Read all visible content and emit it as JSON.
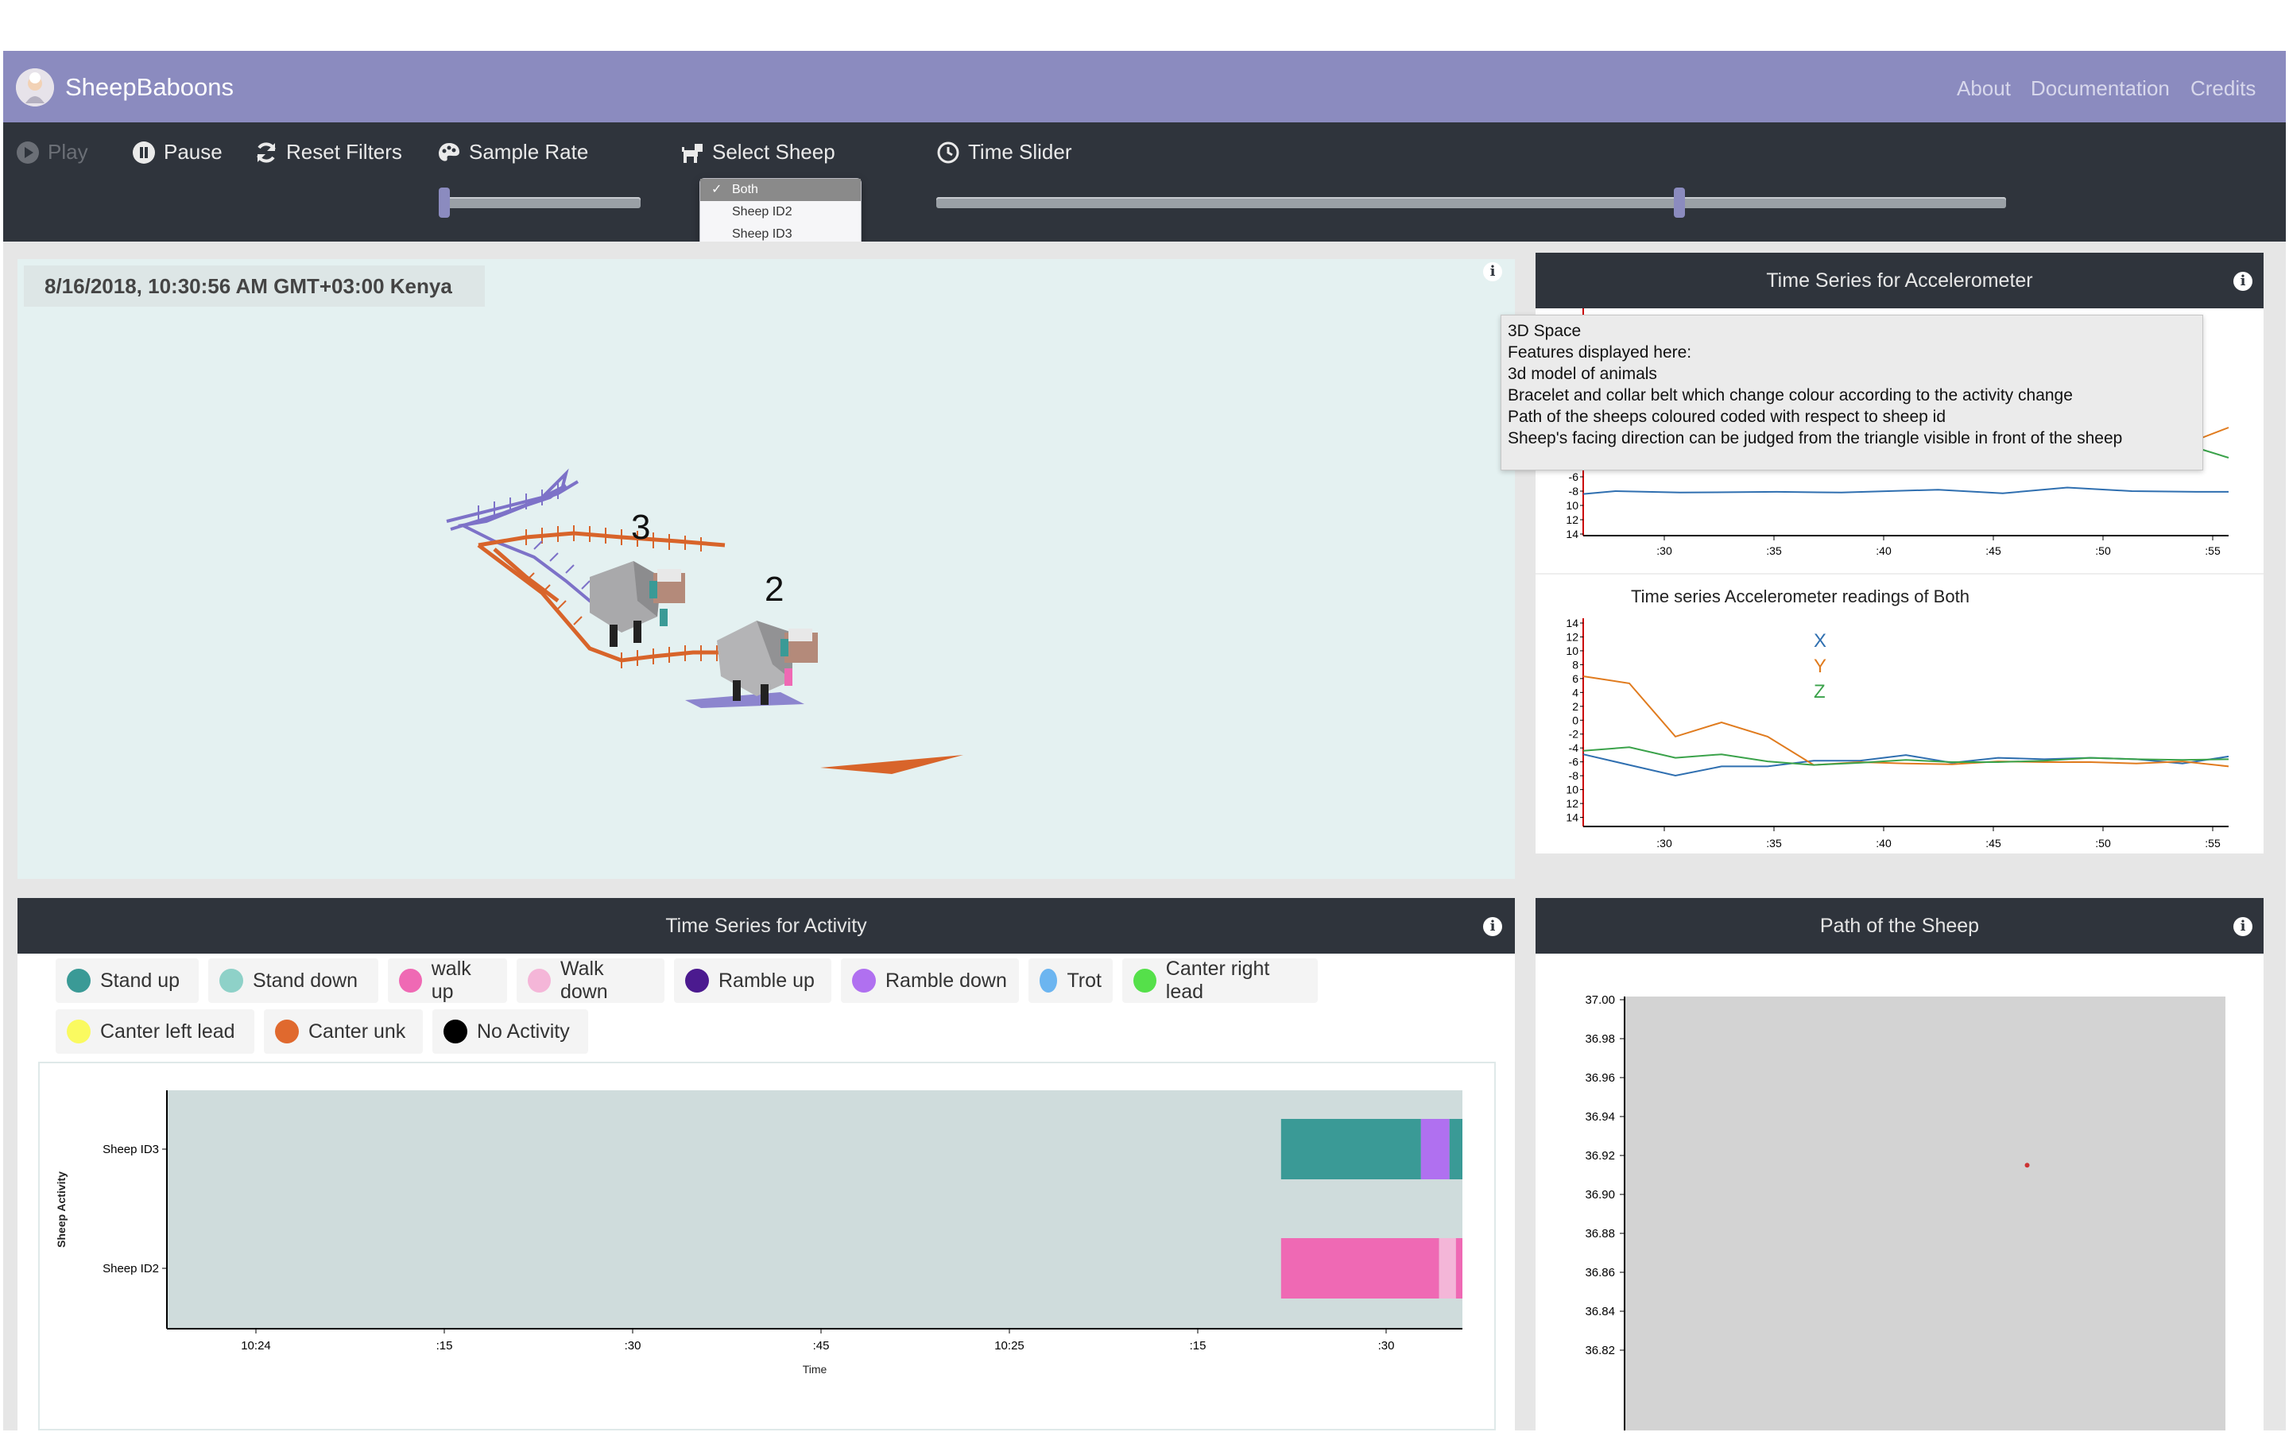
{
  "app": {
    "brand": "SheepBaboons"
  },
  "nav": {
    "about": "About",
    "documentation": "Documentation",
    "credits": "Credits"
  },
  "toolbar": {
    "play": "Play",
    "pause": "Pause",
    "reset": "Reset Filters",
    "sample_rate": "Sample Rate",
    "select_sheep": "Select Sheep",
    "time_slider": "Time Slider",
    "sheep_options": [
      "Both",
      "Sheep ID2",
      "Sheep ID3"
    ],
    "selected_sheep": "Both"
  },
  "scene": {
    "timestamp": "8/16/2018, 10:30:56 AM GMT+03:00 Kenya",
    "labels": [
      "3",
      "2"
    ],
    "tooltip": [
      "3D Space",
      "Features displayed here:",
      "3d model of animals",
      "Bracelet and collar belt which change colour according to the activity change",
      "Path of the sheeps coloured coded with respect to sheep id",
      "Sheep's facing direction can be judged from the triangle visible in front of the sheep"
    ]
  },
  "accel_panel": {
    "title": "Time Series for Accelerometer",
    "chart2_title": "Time series Accelerometer readings of Both",
    "legend": [
      "X",
      "Y",
      "Z"
    ]
  },
  "activity_panel": {
    "title": "Time Series for Activity",
    "legend": [
      {
        "label": "Stand up",
        "color": "#3a9a96"
      },
      {
        "label": "Stand down",
        "color": "#8ed1c8"
      },
      {
        "label": "walk up",
        "color": "#ef69b4"
      },
      {
        "label": "Walk down",
        "color": "#f4b6d8"
      },
      {
        "label": "Ramble up",
        "color": "#4b1a8f"
      },
      {
        "label": "Ramble down",
        "color": "#b070f0"
      },
      {
        "label": "Trot",
        "color": "#6cb5f0"
      },
      {
        "label": "Canter right lead",
        "color": "#55e04a"
      },
      {
        "label": "Canter left lead",
        "color": "#fafa60"
      },
      {
        "label": "Canter unk",
        "color": "#e0692e"
      },
      {
        "label": "No Activity",
        "color": "#000000"
      }
    ]
  },
  "path_panel": {
    "title": "Path of the Sheep"
  },
  "chart_data": [
    {
      "type": "line",
      "title": "",
      "x_ticks": [
        ":30",
        ":35",
        ":40",
        ":45",
        ":50",
        ":55"
      ],
      "y_ticks": [
        "-6",
        "-8",
        "10",
        "12",
        "14"
      ],
      "series": [
        {
          "color": "#2f6fb0",
          "x": [
            0,
            0.05,
            0.15,
            0.3,
            0.4,
            0.55,
            0.65,
            0.75,
            0.85,
            0.95,
            1
          ],
          "y": [
            -8.4,
            -8.0,
            -8.2,
            -8.1,
            -8.2,
            -7.8,
            -8.3,
            -7.5,
            -8.0,
            -8.1,
            -8.1
          ]
        }
      ]
    },
    {
      "type": "line",
      "title": "Time series Accelerometer readings of Both",
      "x_ticks": [
        ":30",
        ":35",
        ":40",
        ":45",
        ":50",
        ":55"
      ],
      "y_ticks": [
        "14",
        "12",
        "10",
        "8",
        "6",
        "4",
        "2",
        "0",
        "-2",
        "-4",
        "-6",
        "-8",
        "10",
        "12",
        "14"
      ],
      "series": [
        {
          "name": "X",
          "color": "#2f6fb0",
          "y": [
            -4.5,
            -6,
            -7.5,
            -6.2,
            -6.2,
            -5.4,
            -5.4,
            -4.6,
            -5.7,
            -5.0,
            -5.2,
            -5.0,
            -5.2,
            -5.8,
            -4.8
          ]
        },
        {
          "name": "Y",
          "color": "#e07b1e",
          "y": [
            6.5,
            5.5,
            -2,
            0,
            -2,
            -6,
            -5.6,
            -5.8,
            -5.9,
            -5.5,
            -5.6,
            -5.6,
            -5.8,
            -5.5,
            -6.2
          ]
        },
        {
          "name": "Z",
          "color": "#3aa24a",
          "y": [
            -4,
            -3.5,
            -5,
            -4.5,
            -5.5,
            -6,
            -5.7,
            -5.3,
            -5.6,
            -5.6,
            -5.4,
            -5.0,
            -5.2,
            -5.3,
            -5.2
          ]
        }
      ]
    },
    {
      "type": "bar",
      "ylabel": "Sheep Activity",
      "xlabel": "Time",
      "x_ticks": [
        "10:24",
        ":15",
        ":30",
        ":45",
        "10:25",
        ":15",
        ":30"
      ],
      "categories": [
        "Sheep ID3",
        "Sheep ID2"
      ],
      "segments": [
        {
          "row": "Sheep ID3",
          "start": 0.86,
          "end": 0.968,
          "color": "#3a9a96"
        },
        {
          "row": "Sheep ID3",
          "start": 0.968,
          "end": 0.99,
          "color": "#b070f0"
        },
        {
          "row": "Sheep ID3",
          "start": 0.99,
          "end": 1.0,
          "color": "#3a9a96"
        },
        {
          "row": "Sheep ID2",
          "start": 0.86,
          "end": 0.982,
          "color": "#ef69b4"
        },
        {
          "row": "Sheep ID2",
          "start": 0.982,
          "end": 0.995,
          "color": "#f4b6d8"
        },
        {
          "row": "Sheep ID2",
          "start": 0.995,
          "end": 1.0,
          "color": "#ef69b4"
        }
      ]
    },
    {
      "type": "scatter",
      "y_ticks": [
        "37.00",
        "36.98",
        "36.96",
        "36.94",
        "36.92",
        "36.90",
        "36.88",
        "36.86",
        "36.84",
        "36.82"
      ],
      "points": [
        {
          "x": 0.67,
          "y": 36.915,
          "color": "#c33"
        }
      ]
    }
  ]
}
